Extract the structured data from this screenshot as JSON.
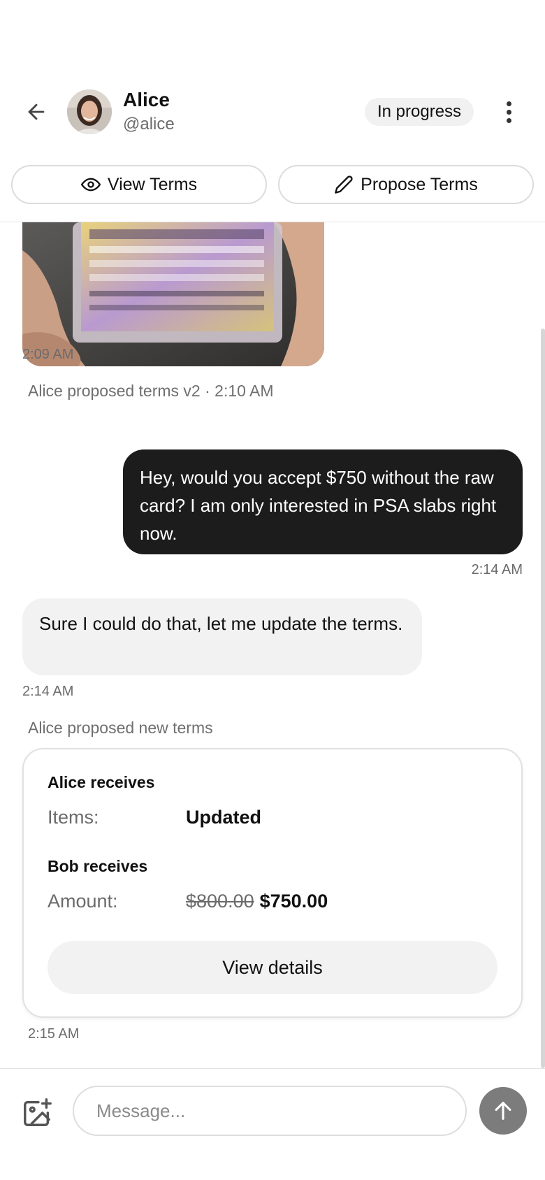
{
  "header": {
    "back_icon": "arrow-left-icon",
    "contact_name": "Alice",
    "contact_handle": "@alice",
    "status": "In progress",
    "more_icon": "more-vertical-icon",
    "view_terms_label": "View Terms",
    "view_terms_icon": "eye-icon",
    "propose_terms_label": "Propose Terms",
    "propose_terms_icon": "pencil-icon"
  },
  "messages": {
    "image_time": "2:09 AM",
    "system_v2": "Alice proposed terms v2 · 2:10 AM",
    "outgoing_text": "Hey, would you accept $750 without the raw card? I am only interested in PSA slabs right now.",
    "outgoing_time": "2:14 AM",
    "incoming_text": "Sure I could do that, let me update the terms.",
    "incoming_time": "2:14 AM",
    "system_new_terms": "Alice proposed new terms"
  },
  "terms_card": {
    "alice_title": "Alice receives",
    "items_label": "Items:",
    "items_value": "Updated",
    "bob_title": "Bob receives",
    "amount_label": "Amount:",
    "amount_old": "$800.00",
    "amount_new": "$750.00",
    "details_label": "View details",
    "time": "2:15 AM"
  },
  "composer": {
    "placeholder": "Message...",
    "attach_icon": "image-plus-icon",
    "send_icon": "arrow-up-icon"
  },
  "colors": {
    "outgoing_bubble": "#1c1c1c",
    "incoming_bubble": "#f2f2f2",
    "send_button": "#7c7c7c",
    "pill_bg": "#f1f1f1"
  }
}
